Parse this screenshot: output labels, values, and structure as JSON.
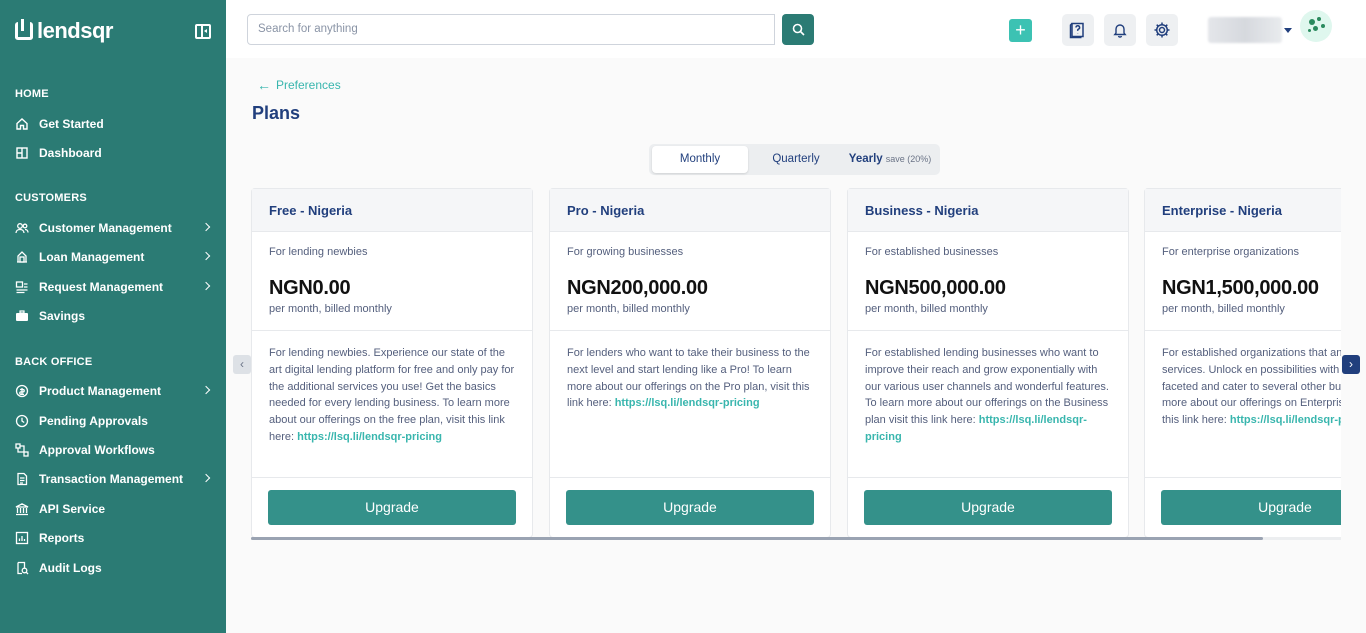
{
  "app": {
    "logo_text": "lendsqr"
  },
  "sidebar": {
    "sections": [
      {
        "title": "HOME"
      },
      {
        "title": "CUSTOMERS"
      },
      {
        "title": "BACK OFFICE"
      }
    ],
    "items": [
      {
        "label": "Get Started",
        "icon": "home-icon"
      },
      {
        "label": "Dashboard",
        "icon": "dashboard-icon"
      },
      {
        "label": "Customer Management",
        "icon": "users-icon",
        "has_submenu": true
      },
      {
        "label": "Loan Management",
        "icon": "loan-icon",
        "has_submenu": true
      },
      {
        "label": "Request Management",
        "icon": "request-icon",
        "has_submenu": true
      },
      {
        "label": "Savings",
        "icon": "briefcase-icon"
      },
      {
        "label": "Product Management",
        "icon": "product-icon",
        "has_submenu": true
      },
      {
        "label": "Pending Approvals",
        "icon": "clock-icon"
      },
      {
        "label": "Approval Workflows",
        "icon": "workflow-icon"
      },
      {
        "label": "Transaction Management",
        "icon": "transaction-icon",
        "has_submenu": true
      },
      {
        "label": "API Service",
        "icon": "bank-icon"
      },
      {
        "label": "Reports",
        "icon": "reports-icon"
      },
      {
        "label": "Audit Logs",
        "icon": "audit-icon"
      }
    ]
  },
  "topbar": {
    "search_placeholder": "Search for anything"
  },
  "main": {
    "back_label": "Preferences",
    "title": "Plans",
    "tabs": [
      {
        "label": "Monthly",
        "active": true
      },
      {
        "label": "Quarterly",
        "active": false
      },
      {
        "label": "Yearly",
        "badge": "save (20%)",
        "active": false
      }
    ],
    "plans": [
      {
        "name": "Free - Nigeria",
        "subtitle": "For lending newbies",
        "price": "NGN0.00",
        "period": "per month, billed monthly",
        "description": "For lending newbies. Experience our state of the art digital lending platform for free and only pay for the additional services you use! Get the basics needed for every lending business. To learn more about our offerings on the free plan, visit this link here:",
        "link": "https://lsq.li/lendsqr-pricing",
        "button": "Upgrade"
      },
      {
        "name": "Pro - Nigeria",
        "subtitle": "For growing businesses",
        "price": "NGN200,000.00",
        "period": "per month, billed monthly",
        "description": "For lenders who want to take their business to the next level and start lending like a Pro! To learn more about our offerings on the Pro plan, visit this link here:",
        "link": "https://lsq.li/lendsqr-pricing",
        "button": "Upgrade"
      },
      {
        "name": "Business - Nigeria",
        "subtitle": "For established businesses",
        "price": "NGN500,000.00",
        "period": "per month, billed monthly",
        "description": "For established lending businesses who want to improve their reach and grow exponentially with our various user channels and wonderful features. To learn more about our offerings on the Business plan visit this link here:",
        "link": "https://lsq.li/lendsqr-pricing",
        "button": "Upgrade"
      },
      {
        "name": "Enterprise - Nigeria",
        "subtitle": "For enterprise organizations",
        "price": "NGN1,500,000.00",
        "period": "per month, billed monthly",
        "description": "For established organizations that and additional services. Unlock en possibilities with our multi-faceted and cater to several other busines learn more about our offerings on Enterprise plan, visit this link here:",
        "link": "https://lsq.li/lendsqr-pricing",
        "button": "Upgrade"
      }
    ]
  },
  "colors": {
    "sidebar_bg": "#2b7b74",
    "accent": "#39b6ae",
    "primary_text": "#213f7d",
    "button": "#34918a"
  }
}
